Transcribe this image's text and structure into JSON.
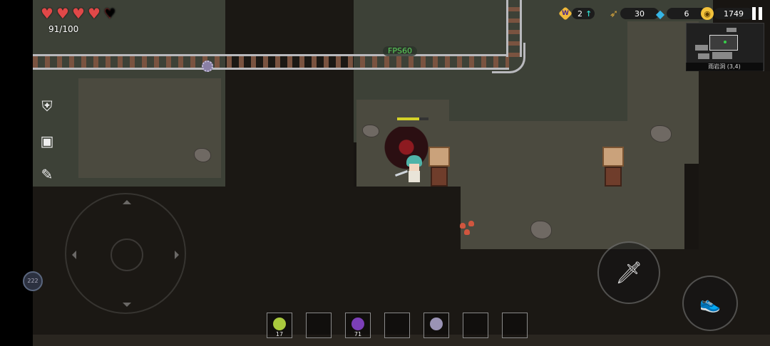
{
  "hud": {
    "hearts": [
      "full",
      "full",
      "full",
      "full",
      "half"
    ],
    "hp_text": "91/100"
  },
  "stats": {
    "level_value": "2",
    "bow_value": "30",
    "gem_value": "6",
    "gold_value": "1749"
  },
  "fps": "FPS60",
  "minimap": {
    "label": "雨岩洞 (3,4)"
  },
  "ping": "222",
  "inventory": {
    "slots": [
      {
        "item": "leaf",
        "count": "17"
      },
      {
        "item": "empty",
        "count": ""
      },
      {
        "item": "bomb",
        "count": "71"
      },
      {
        "item": "empty",
        "count": ""
      },
      {
        "item": "spike",
        "count": ""
      },
      {
        "item": "empty",
        "count": ""
      },
      {
        "item": "empty",
        "count": ""
      }
    ]
  },
  "colors": {
    "heart": "#e04848",
    "fps": "#5bd35b",
    "gold": "#f3c23a",
    "gem": "#36b6e6",
    "boss_hp": "#d4d228"
  },
  "boss_hp_fraction": 0.7,
  "icons": {
    "armor": "shield-sword-icon",
    "backpack": "backpack-icon",
    "skill": "skill-icon",
    "attack": "sword-icon",
    "dash": "shoe-icon"
  }
}
